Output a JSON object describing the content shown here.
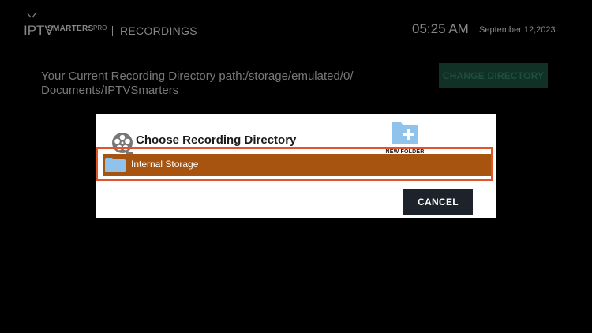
{
  "header": {
    "logo_iptv": "IPTV",
    "logo_smarters": "SMARTERS",
    "logo_pro": "PRO",
    "section_title": "RECORDINGS",
    "time": "05:25 AM",
    "date": "September 12,2023"
  },
  "main": {
    "path_text": "Your Current Recording Directory path:/storage/emulated/0/ Documents/IPTVSmarters",
    "change_directory_label": "CHANGE DIRECTORY"
  },
  "dialog": {
    "title": "Choose Recording Directory",
    "new_folder_label": "NEW FOLDER",
    "items": [
      {
        "label": "Internal Storage",
        "icon": "folder-icon"
      }
    ],
    "cancel_label": "CANCEL"
  },
  "colors": {
    "background": "#000000",
    "selected_row": "#a65410",
    "highlight_border": "#e2552a",
    "change_button": "#1b4a3b",
    "cancel_button": "#1e222b",
    "folder_blue": "#8fc3ec"
  }
}
